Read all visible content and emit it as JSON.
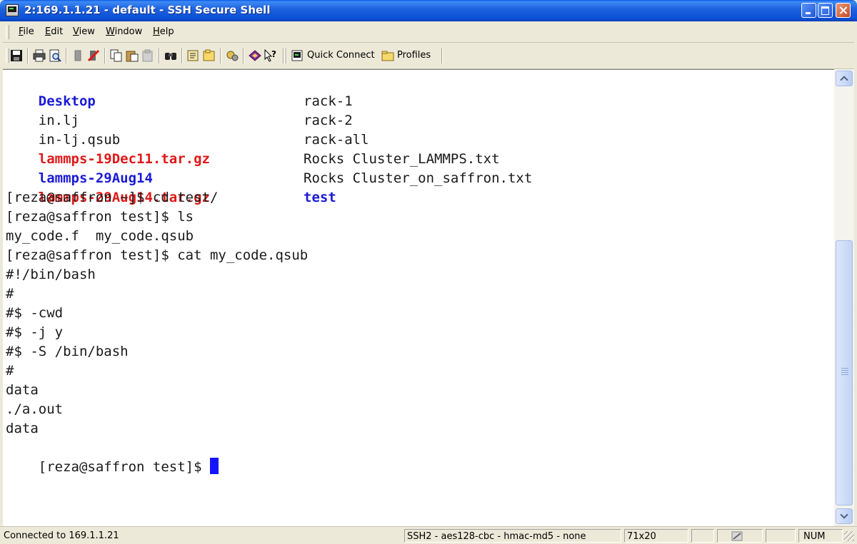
{
  "window": {
    "title": "2:169.1.1.21 - default - SSH Secure Shell"
  },
  "menu": {
    "file_rest": "ile",
    "file_u": "F",
    "edit_rest": "dit",
    "edit_u": "E",
    "view_rest": "iew",
    "view_u": "V",
    "window_rest": "indow",
    "window_u": "W",
    "help_rest": "elp",
    "help_u": "H"
  },
  "toolbar": {
    "quick_connect": "Quick Connect",
    "profiles": "Profiles"
  },
  "terminal": {
    "listing": [
      {
        "left": "Desktop",
        "left_type": "dir",
        "right": "rack-1",
        "right_type": "plain"
      },
      {
        "left": "in.lj",
        "left_type": "plain",
        "right": "rack-2",
        "right_type": "plain"
      },
      {
        "left": "in-lj.qsub",
        "left_type": "plain",
        "right": "rack-all",
        "right_type": "plain"
      },
      {
        "left": "lammps-19Dec11.tar.gz",
        "left_type": "arch",
        "right": "Rocks Cluster_LAMMPS.txt",
        "right_type": "plain"
      },
      {
        "left": "lammps-29Aug14",
        "left_type": "dir",
        "right": "Rocks Cluster_on_saffron.txt",
        "right_type": "plain"
      },
      {
        "left": "lammps-29Aug14.tar.gz",
        "left_type": "arch",
        "right": "test",
        "right_type": "dir"
      }
    ],
    "lines": [
      "[reza@saffron ~]$ cd test/",
      "[reza@saffron test]$ ls",
      "my_code.f  my_code.qsub",
      "[reza@saffron test]$ cat my_code.qsub",
      "#!/bin/bash",
      "#",
      "#$ -cwd",
      "#$ -j y",
      "#$ -S /bin/bash",
      "#",
      "data",
      "./a.out",
      "data"
    ],
    "prompt": "[reza@saffron test]$ "
  },
  "statusbar": {
    "connection": "Connected to 169.1.1.21",
    "protocol": "SSH2 - aes128-cbc - hmac-md5 - none",
    "size": "71x20",
    "num": "NUM"
  }
}
